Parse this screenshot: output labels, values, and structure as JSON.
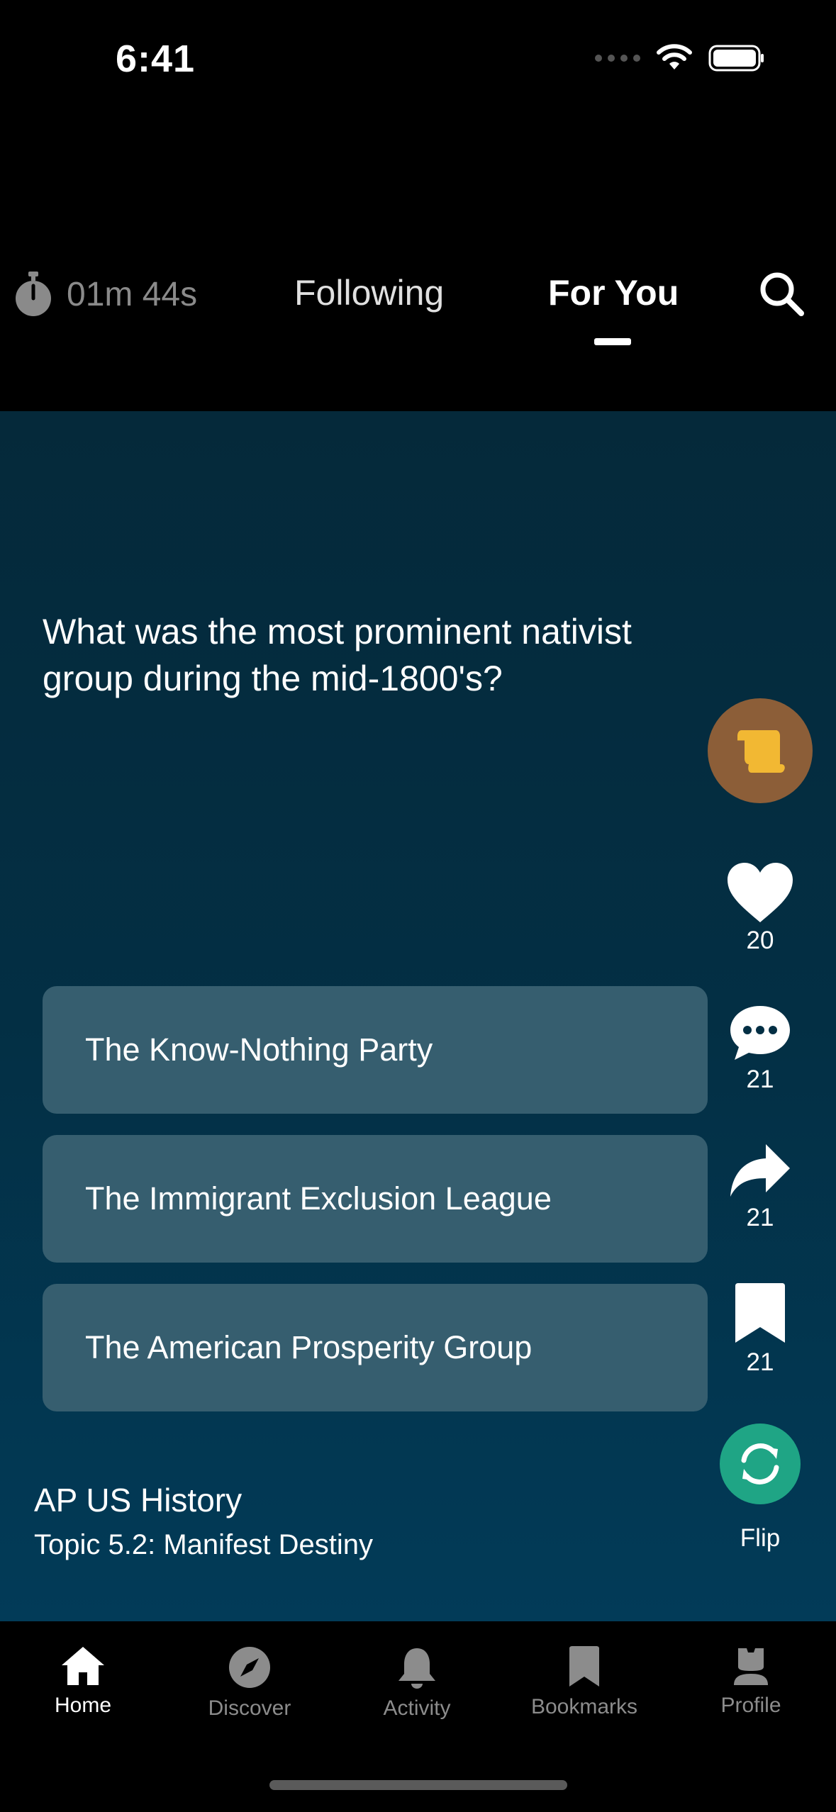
{
  "status_bar": {
    "time": "6:41"
  },
  "header": {
    "timer": "01m 44s",
    "tabs": [
      {
        "label": "Following",
        "active": false
      },
      {
        "label": "For You",
        "active": true
      }
    ]
  },
  "card": {
    "question": "What was the most prominent nativist group during the mid-1800's?",
    "answers": [
      "The Know-Nothing Party",
      "The Immigrant Exclusion League",
      "The American Prosperity Group"
    ],
    "course": "AP US History",
    "topic": "Topic 5.2: Manifest Destiny"
  },
  "actions": {
    "likes": "20",
    "comments": "21",
    "shares": "21",
    "bookmarks": "21",
    "flip_label": "Flip"
  },
  "tabbar": {
    "items": [
      {
        "label": "Home",
        "icon": "home-icon",
        "active": true
      },
      {
        "label": "Discover",
        "icon": "compass-icon",
        "active": false
      },
      {
        "label": "Activity",
        "icon": "bell-icon",
        "active": false
      },
      {
        "label": "Bookmarks",
        "icon": "bookmark-icon",
        "active": false
      },
      {
        "label": "Profile",
        "icon": "profile-icon",
        "active": false
      }
    ]
  },
  "colors": {
    "card_top": "#05293a",
    "card_bottom": "#023b58",
    "answer_bg": "#365e6f",
    "scroll_badge": "#8c5e38",
    "scroll_icon": "#f2b833",
    "flip": "#1fa585"
  }
}
